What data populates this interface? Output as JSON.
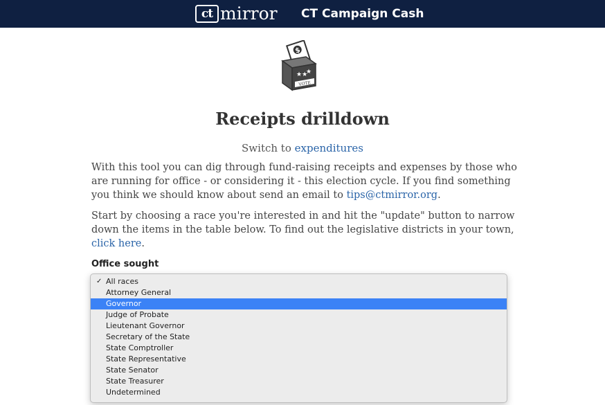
{
  "header": {
    "logo_mark": "ct",
    "logo_word": "mirror",
    "site_title": "CT Campaign Cash"
  },
  "icons": {
    "vote_box": "ballot-box-with-dollar-icon",
    "vote_box_label": "VOTE"
  },
  "page": {
    "title": "Receipts drilldown",
    "switch_prefix": "Switch to",
    "switch_link": "expenditures",
    "intro_text": "With this tool you can dig through fund-raising receipts and expenses by those who are running for office - or considering it - this election cycle. If you find something you think we should know about send an email to",
    "intro_email": "tips@ctmirror.org",
    "intro_end": ".",
    "instructions_text": "Start by choosing a race you're interested in and hit the \"update\" button to narrow down the items in the table below. To find out the legislative districts in your town,",
    "instructions_link": "click here",
    "instructions_end": "."
  },
  "filter": {
    "label": "Office sought",
    "check_mark": "✓",
    "selected": "All races",
    "highlighted": "Governor",
    "options": [
      "All races",
      "Attorney General",
      "Governor",
      "Judge of Probate",
      "Lieutenant Governor",
      "Secretary of the State",
      "State Comptroller",
      "State Representative",
      "State Senator",
      "State Treasurer",
      "Undetermined"
    ]
  },
  "colors": {
    "header_bg": "#0f2041",
    "link": "#2a64a8",
    "highlight": "#3b82f6"
  }
}
